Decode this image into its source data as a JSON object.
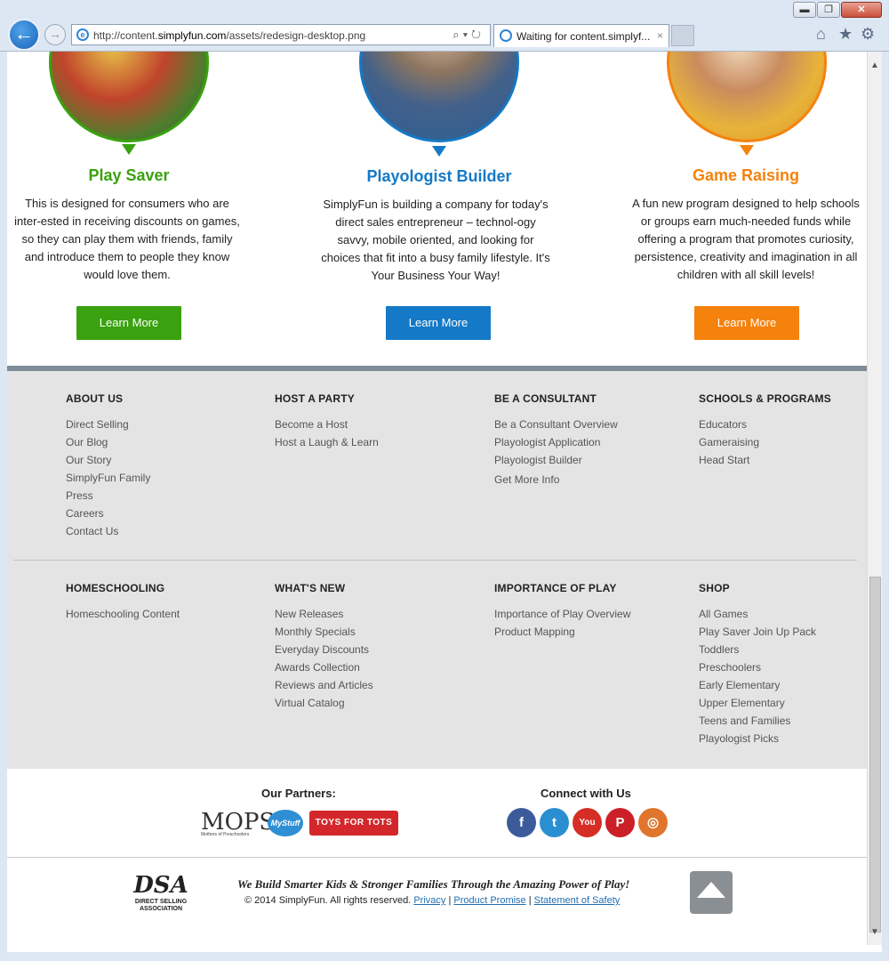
{
  "browser": {
    "url_prefix": "http://content.",
    "url_domain": "simplyfun.com",
    "url_path": "/assets/redesign-desktop.png",
    "tab_title": "Waiting for content.simplyf...",
    "min_glyph": "▬",
    "max_glyph": "❐",
    "close_glyph": "✕",
    "back_glyph": "←",
    "forward_glyph": "→",
    "ie_glyph": "e",
    "address_tools": "⌕▾↻",
    "tab_close": "×",
    "home_glyph": "⌂",
    "star_glyph": "★",
    "gear_glyph": "⚙",
    "scroll_up_glyph": "▲",
    "scroll_down_glyph": "▼"
  },
  "programs": [
    {
      "title": "Play Saver",
      "desc": "This is designed for consumers who are inter-ested in receiving discounts on games, so they can play them with friends, family  and introduce them to people they know would love them.",
      "button": "Learn More",
      "color": "#3aa10f"
    },
    {
      "title": "Playologist Builder",
      "desc": "SimplyFun is building a company for today's direct sales entrepreneur – technol-ogy savvy, mobile oriented, and looking for choices that fit into a busy family lifestyle. It's Your Business Your Way!",
      "button": "Learn More",
      "color": "#1479c6"
    },
    {
      "title": "Game Raising",
      "desc": "A fun new program designed to help schools or groups earn much-needed funds while offering a program that promotes curiosity, persistence, creativity and imagination in all children with all skill levels!",
      "button": "Learn More",
      "color": "#f5820d"
    }
  ],
  "footer": {
    "columns_top": [
      {
        "heading": "ABOUT US",
        "links": [
          "Direct Selling",
          "Our Blog",
          "Our Story",
          "SimplyFun Family",
          "Press",
          "Careers",
          "Contact Us"
        ]
      },
      {
        "heading": "HOST A PARTY",
        "links": [
          "Become a Host",
          "Host a Laugh & Learn"
        ]
      },
      {
        "heading": "BE A CONSULTANT",
        "links": [
          "Be a Consultant Overview",
          "Playologist Application",
          "Playologist Builder",
          "Get More Info"
        ]
      },
      {
        "heading": "SCHOOLS & PROGRAMS",
        "links": [
          "Educators",
          "Gameraising",
          "Head Start"
        ]
      }
    ],
    "columns_bottom": [
      {
        "heading": "HOMESCHOOLING",
        "links": [
          "Homeschooling Content"
        ]
      },
      {
        "heading": "WHAT'S NEW",
        "links": [
          "New Releases",
          "Monthly Specials",
          "Everyday Discounts",
          "Awards Collection",
          "Reviews and Articles",
          "Virtual Catalog"
        ]
      },
      {
        "heading": "IMPORTANCE OF PLAY",
        "links": [
          "Importance of Play Overview",
          "Product Mapping"
        ]
      },
      {
        "heading": "SHOP",
        "links": [
          "All Games",
          "Play Saver Join Up Pack",
          "Toddlers",
          "Preschoolers",
          "Early Elementary",
          "Upper Elementary",
          "Teens and Families",
          "Playologist Picks"
        ]
      }
    ]
  },
  "partners": {
    "title": "Our Partners:",
    "mops": "MOPS",
    "mops_sub": "Mothers of Preschoolers",
    "mystuff": "MyStuff",
    "toys": "TOYS FOR TOTS"
  },
  "connect": {
    "title": "Connect with Us",
    "icons": [
      {
        "name": "facebook",
        "glyph": "f",
        "color": "#3b5b9a"
      },
      {
        "name": "twitter",
        "glyph": "t",
        "color": "#2a8fd0"
      },
      {
        "name": "youtube",
        "glyph": "You",
        "color": "#d62d24"
      },
      {
        "name": "pinterest",
        "glyph": "P",
        "color": "#cb2027"
      },
      {
        "name": "instagram",
        "glyph": "◎",
        "color": "#e0752d"
      }
    ]
  },
  "bottom": {
    "dsa_mark": "DSA",
    "dsa_sub": "DIRECT SELLING ASSOCIATION",
    "tagline": "We Build Smarter Kids & Stronger Families Through the Amazing Power of Play!",
    "copyright": "© 2014 SimplyFun. All rights reserved.",
    "privacy": "Privacy",
    "promise": "Product Promise",
    "safety": "Statement of Safety",
    "sep": "|"
  }
}
